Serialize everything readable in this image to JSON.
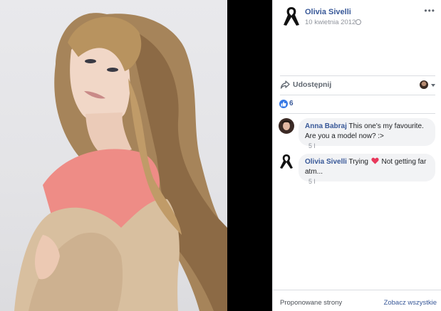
{
  "post": {
    "author": "Olivia Sivelli",
    "date": "10 kwietnia 2012",
    "privacy_icon": "globe-icon",
    "more_icon": "more-options-icon"
  },
  "actions": {
    "share_label": "Udostępnij"
  },
  "reactions": {
    "like_count": "6",
    "like_color": "#3578e5"
  },
  "comments": [
    {
      "author": "Anna Babraj",
      "text": "This one's my favourite. Are you a model now? :>",
      "time": "5 l"
    },
    {
      "author": "Olivia Sivelli",
      "text_before": "Trying",
      "text_after": "Not getting far atm...",
      "time": "5 l"
    }
  ],
  "footer": {
    "suggested_label": "Proponowane strony",
    "see_all_label": "Zobacz wszystkie"
  },
  "colors": {
    "link_blue": "#385898",
    "photo_background": "#e6e6e9",
    "lightbox_black": "#000000"
  }
}
